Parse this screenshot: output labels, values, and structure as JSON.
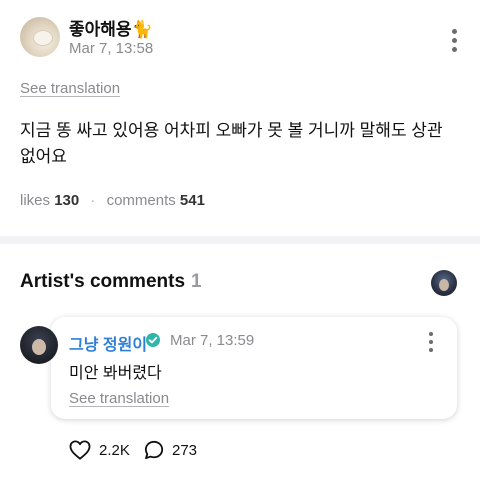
{
  "post": {
    "author": "좋아해용🐈",
    "time": "Mar 7, 13:58",
    "see_translation": "See translation",
    "body": "지금 똥 싸고 있어용 어차피 오빠가 못 볼 거니까 말해도 상관 없어요",
    "likes_label": "likes",
    "likes_count": "130",
    "comments_label": "comments",
    "comments_count": "541"
  },
  "artist_comments": {
    "title": "Artist's comments",
    "count": "1"
  },
  "comment": {
    "author": "그냥 정원이",
    "time": "Mar 7, 13:59",
    "body": "미안 봐버렸다",
    "see_translation": "See translation",
    "like_count": "2.2K",
    "reply_count": "273"
  },
  "icons": {
    "more": "more-vertical-icon",
    "verified": "verified-badge-icon",
    "like": "heart-outline-icon",
    "reply": "speech-bubble-icon"
  },
  "colors": {
    "artist_name": "#2f7fd8",
    "verified_badge": "#2fb6a8",
    "muted_text": "#8a8a8f"
  }
}
